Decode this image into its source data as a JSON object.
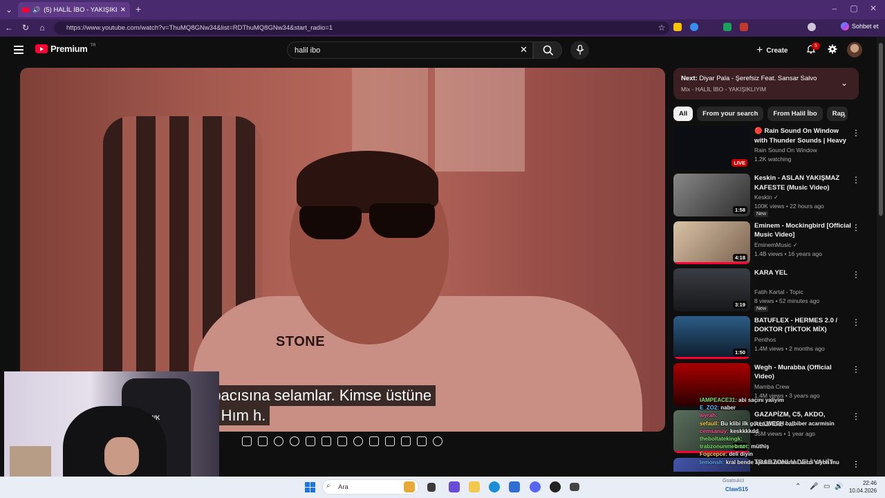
{
  "browser": {
    "tab_title": "(5) HALİL İBO - YAKIŞIKLIYIM",
    "url": "https://www.youtube.com/watch?v=ThuMQ8GNw34&list=RDThuMQ8GNw34&start_radio=1",
    "copilot_label": "Sohbet et"
  },
  "header": {
    "logo_text": "Premium",
    "region": "TR",
    "search_value": "halil ibo",
    "create_label": "Create",
    "notif_count": "5"
  },
  "video": {
    "subtitle_line1": "n bacısına selamlar. Kimse üstüne",
    "subtitle_line2": "ın. Hım h.",
    "jacket_text": "STONE"
  },
  "webcam": {
    "chair_text": "HAWK"
  },
  "up_next": {
    "prefix": "Next:",
    "title": "Diyar Pala - Şerefsiz Feat. Sansar Salvo",
    "mix": "Mix - HALİL İBO - YAKIŞIKLIYIM"
  },
  "chips": [
    "All",
    "From your search",
    "From Halil İbo",
    "Rap"
  ],
  "recommendations": [
    {
      "title": "🔴 Rain Sound On Window with Thunder Sounds | Heavy Rain ...",
      "channel": "Rain Sound On Window",
      "meta": "1.2K watching",
      "duration": "LIVE",
      "badge": "",
      "thumb_color": "#0b0d12"
    },
    {
      "title": "Keskin - ASLAN YAKIŞMAZ KAFESTE (Music Video)",
      "channel": "Keskin ✓",
      "meta": "100K views • 22 hours ago",
      "duration": "1:58",
      "badge": "New",
      "thumb_color": "#6d6d6d"
    },
    {
      "title": "Eminem - Mockingbird [Official Music Video]",
      "channel": "EminemMusic ✓",
      "meta": "1.4B views • 16 years ago",
      "duration": "4:18",
      "badge": "",
      "thumb_color": "#b79a7a"
    },
    {
      "title": "KARA YEL",
      "channel": "Fatih Kartal - Topic",
      "meta": "8 views • 52 minutes ago",
      "duration": "3:19",
      "badge": "New",
      "thumb_color": "#2a2c30"
    },
    {
      "title": "BATUFLEX - HERMES 2.0 / DOKTOR (TİKTOK MİX)",
      "channel": "Penthos",
      "meta": "1.4M views • 2 months ago",
      "duration": "1:50",
      "badge": "",
      "thumb_color": "#1f3b55"
    },
    {
      "title": "Wegh - Murabba (Official Video)",
      "channel": "Mamba Crew",
      "meta": "1.4M views • 3 years ago",
      "duration": "",
      "badge": "",
      "thumb_color": "#5a0a0a"
    },
    {
      "title": "GAZAPİZM, C5, AKDO, ALIZADE - ...",
      "channel": "...",
      "meta": "35M views • 1 year ago",
      "duration": "2:22",
      "badge": "",
      "thumb_color": "#3a4a3e"
    },
    {
      "title": "TRABZONLU DELİ VAHİT",
      "channel": "",
      "meta": "",
      "duration": "",
      "badge": "",
      "thumb_color": "#2a3a7a"
    }
  ],
  "chat": [
    {
      "user": "IAMPEACE31:",
      "msg": "abi saçını yaliyim"
    },
    {
      "user": "E_ZO2:",
      "msg": "naber"
    },
    {
      "user": "wyrah:",
      "msg": ""
    },
    {
      "user": "sefaull:",
      "msg": "Bu klibi ilk gören WEGH balbiber acarmisin"
    },
    {
      "user": "cemsanuy:",
      "msg": "keskkkkdd"
    },
    {
      "user": "theboltatekingk:",
      "msg": ""
    },
    {
      "user": "trabzonunmehmet:",
      "msg": "müthiş"
    },
    {
      "user": "Fogcepce:",
      "msg": "deli diyin"
    },
    {
      "user": "lemonsh:",
      "msg": "kral bende ajdaim numarası verdi siyon mu"
    }
  ],
  "taskbar": {
    "search_placeholder": "Ara",
    "tray_user": "ClawS15",
    "tray_small": "Goalsuki3",
    "time": "22:46",
    "date": "10.04.2026"
  }
}
